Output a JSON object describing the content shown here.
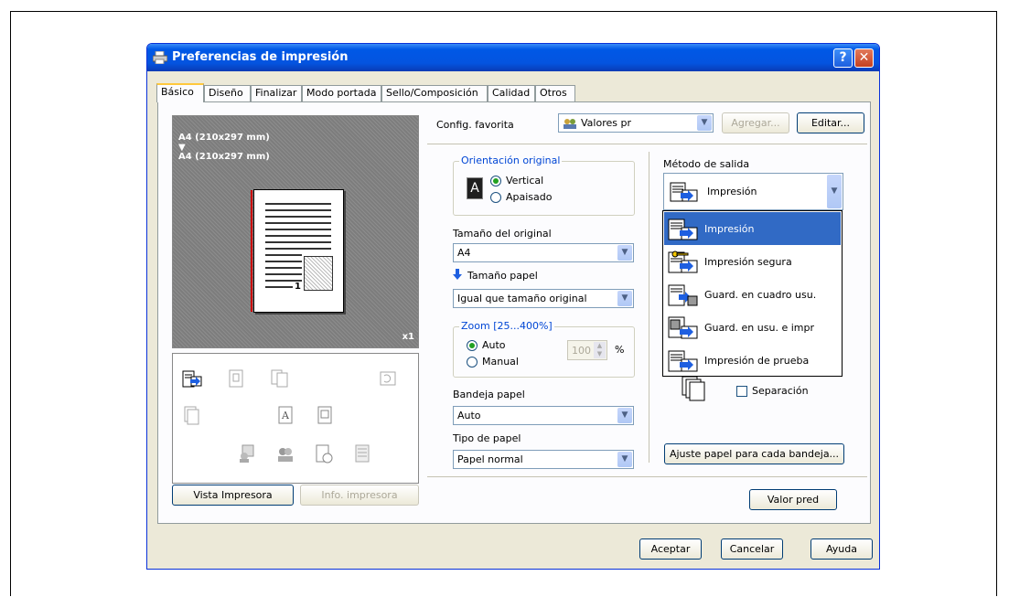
{
  "window": {
    "title": "Preferencias de impresión",
    "help_glyph": "?",
    "close_glyph": "✕"
  },
  "tabs": [
    "Básico",
    "Diseño",
    "Finalizar",
    "Modo portada",
    "Sello/Composición",
    "Calidad",
    "Otros"
  ],
  "preview": {
    "original_size": "A4 (210x297 mm)",
    "arrow": "▼",
    "paper_size": "A4 (210x297 mm)",
    "copies": "x1",
    "page_number": "1"
  },
  "left_buttons": {
    "printer_view": "Vista Impresora",
    "printer_info": "Info. impresora"
  },
  "favorite": {
    "label": "Config. favorita",
    "value": "Valores pr",
    "add_label": "Agregar...",
    "edit_label": "Editar..."
  },
  "orientation": {
    "title": "Orientación original",
    "options": [
      "Vertical",
      "Apaisado"
    ],
    "selected": "Vertical",
    "icon_letter": "A"
  },
  "original_size": {
    "label": "Tamaño del original",
    "value": "A4"
  },
  "paper_size": {
    "label": "Tamaño papel",
    "value": "Igual que tamaño original"
  },
  "zoom": {
    "title": "Zoom [25...400%]",
    "options": [
      "Auto",
      "Manual"
    ],
    "selected": "Auto",
    "value": "100",
    "unit": "%"
  },
  "paper_tray": {
    "label": "Bandeja papel",
    "value": "Auto"
  },
  "paper_type": {
    "label": "Tipo de papel",
    "value": "Papel normal"
  },
  "output": {
    "label": "Método de salida",
    "value": "Impresión",
    "options": [
      "Impresión",
      "Impresión segura",
      "Guard. en cuadro usu.",
      "Guard. en usu. e impr",
      "Impresión de prueba"
    ],
    "highlighted": "Impresión",
    "separation_label": "Separación",
    "separation_checked": false,
    "tray_paper_button": "Ajuste papel para cada bandeja..."
  },
  "defaults_button": "Valor pred",
  "footer": {
    "ok": "Aceptar",
    "cancel": "Cancelar",
    "help": "Ayuda"
  },
  "colors": {
    "title_bar": "#0058e6",
    "selection": "#316ac5",
    "group_title": "#0046d5"
  }
}
